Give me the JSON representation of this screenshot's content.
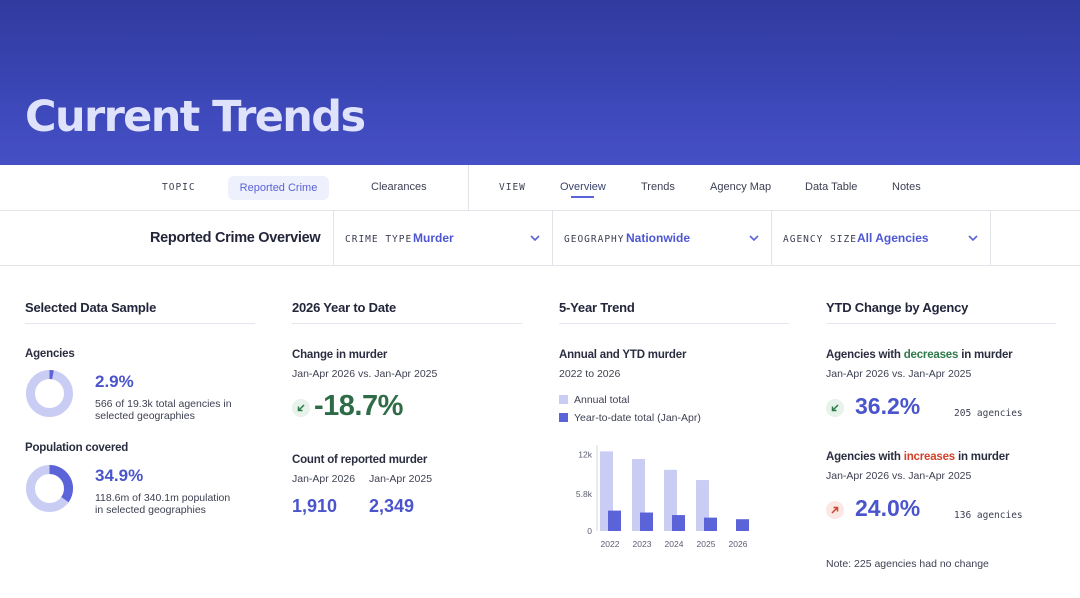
{
  "hero": {
    "title": "Current Trends"
  },
  "nav": {
    "topic_label": "TOPIC",
    "topics": [
      "Reported Crime",
      "Clearances"
    ],
    "view_label": "VIEW",
    "views": [
      "Overview",
      "Trends",
      "Agency Map",
      "Data Table",
      "Notes"
    ],
    "active_topic": "Reported Crime",
    "active_view": "Overview"
  },
  "filters": {
    "title": "Reported Crime Overview",
    "crime_type": {
      "label": "CRIME TYPE",
      "value": "Murder"
    },
    "geography": {
      "label": "GEOGRAPHY",
      "value": "Nationwide"
    },
    "agency_size": {
      "label": "AGENCY SIZE",
      "value": "All Agencies"
    }
  },
  "sample": {
    "title": "Selected Data Sample",
    "agencies": {
      "label": "Agencies",
      "pct": "2.9%",
      "fraction": 0.029,
      "line1": "566 of 19.3k total agencies in",
      "line2": "selected geographies"
    },
    "population": {
      "label": "Population covered",
      "pct": "34.9%",
      "fraction": 0.349,
      "line1": "118.6m of 340.1m population",
      "line2": "in selected geographies"
    }
  },
  "ytd": {
    "title": "2026 Year to Date",
    "change_label": "Change in murder",
    "change_period": "Jan-Apr 2026 vs. Jan-Apr 2025",
    "change_value": "-18.7%",
    "count_label": "Count of reported murder",
    "period_a": "Jan-Apr 2026",
    "period_b": "Jan-Apr 2025",
    "count_a": "1,910",
    "count_b": "2,349"
  },
  "trend": {
    "title": "5-Year Trend",
    "subtitle": "Annual and YTD murder",
    "range": "2022 to 2026",
    "legend_annual": "Annual total",
    "legend_ytd": "Year-to-date total (Jan-Apr)"
  },
  "chart_data": {
    "type": "bar",
    "categories": [
      "2022",
      "2023",
      "2024",
      "2025",
      "2026"
    ],
    "y_ticks": [
      "12k",
      "5.8k",
      "0"
    ],
    "ylim": [
      0,
      13500
    ],
    "series": [
      {
        "name": "Annual total",
        "values": [
          12500,
          11300,
          9600,
          8000,
          null
        ]
      },
      {
        "name": "Year-to-date total (Jan-Apr)",
        "values": [
          3200,
          2900,
          2500,
          2100,
          1850
        ]
      }
    ],
    "colors": {
      "annual": "#c9cdf4",
      "ytd": "#5a63d8"
    }
  },
  "agency_change": {
    "title": "YTD Change by Agency",
    "dec_prefix": "Agencies with ",
    "dec_word": "decreases",
    "dec_suffix": " in murder",
    "dec_period": "Jan-Apr 2026 vs. Jan-Apr 2025",
    "dec_pct": "36.2%",
    "dec_count": "205 agencies",
    "inc_prefix": "Agencies with ",
    "inc_word": "increases",
    "inc_suffix": " in murder",
    "inc_period": "Jan-Apr 2026 vs. Jan-Apr 2025",
    "inc_pct": "24.0%",
    "inc_count": "136 agencies",
    "note": "Note: 225 agencies had no change"
  },
  "icons": {
    "chevron": "chevron-down-icon",
    "down_arrow": "arrow-down-left-icon",
    "up_arrow": "arrow-up-right-icon"
  },
  "colors": {
    "accent": "#4d57d2",
    "green": "#2e7a4b",
    "red": "#d2412a",
    "hero": "#3b46b6"
  }
}
